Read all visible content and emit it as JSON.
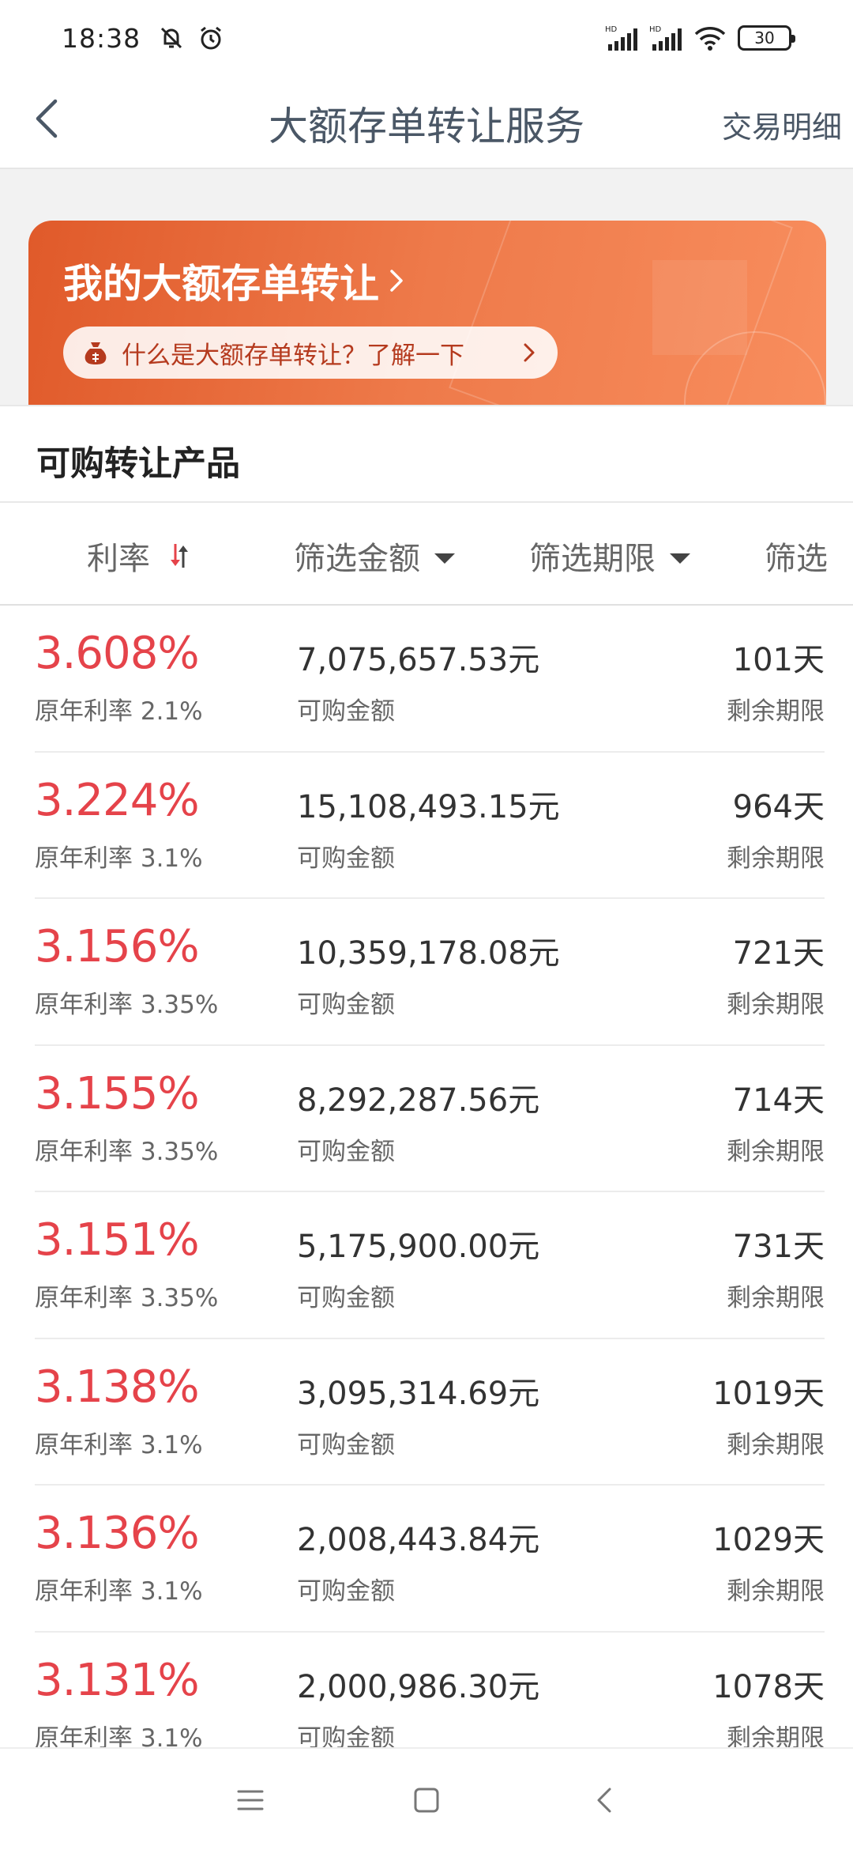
{
  "status": {
    "time": "18:38",
    "battery": "30"
  },
  "nav": {
    "title": "大额存单转让服务",
    "right_link": "交易明细"
  },
  "banner": {
    "title": "我的大额存单转让",
    "pill_text": "什么是大额存单转让？了解一下"
  },
  "section": {
    "title": "可购转让产品"
  },
  "filters": [
    {
      "label": "利率"
    },
    {
      "label": "筛选金额"
    },
    {
      "label": "筛选期限"
    },
    {
      "label": "筛选"
    }
  ],
  "products": [
    {
      "rate": "3.608%",
      "orig": "原年利率 2.1%",
      "amount": "7,075,657.53元",
      "amount_label": "可购金额",
      "term": "101天",
      "term_label": "剩余期限"
    },
    {
      "rate": "3.224%",
      "orig": "原年利率 3.1%",
      "amount": "15,108,493.15元",
      "amount_label": "可购金额",
      "term": "964天",
      "term_label": "剩余期限"
    },
    {
      "rate": "3.156%",
      "orig": "原年利率 3.35%",
      "amount": "10,359,178.08元",
      "amount_label": "可购金额",
      "term": "721天",
      "term_label": "剩余期限"
    },
    {
      "rate": "3.155%",
      "orig": "原年利率 3.35%",
      "amount": "8,292,287.56元",
      "amount_label": "可购金额",
      "term": "714天",
      "term_label": "剩余期限"
    },
    {
      "rate": "3.151%",
      "orig": "原年利率 3.35%",
      "amount": "5,175,900.00元",
      "amount_label": "可购金额",
      "term": "731天",
      "term_label": "剩余期限"
    },
    {
      "rate": "3.138%",
      "orig": "原年利率 3.1%",
      "amount": "3,095,314.69元",
      "amount_label": "可购金额",
      "term": "1019天",
      "term_label": "剩余期限"
    },
    {
      "rate": "3.136%",
      "orig": "原年利率 3.1%",
      "amount": "2,008,443.84元",
      "amount_label": "可购金额",
      "term": "1029天",
      "term_label": "剩余期限"
    },
    {
      "rate": "3.131%",
      "orig": "原年利率 3.1%",
      "amount": "2,000,986.30元",
      "amount_label": "可购金额",
      "term": "1078天",
      "term_label": "剩余期限"
    }
  ],
  "colors": {
    "rate_red": "#e5434a",
    "banner_orange": "#ee7a4a",
    "nav_text": "#4a5766"
  },
  "icons": {
    "status_left": [
      "bell-off-icon",
      "alarm-icon"
    ],
    "status_right": [
      "signal-hd-icon",
      "signal-hd-icon",
      "wifi-icon",
      "battery-icon"
    ],
    "nav_back": "back-arrow-icon",
    "pill": "money-bag-icon",
    "sort": "sort-arrows-icon",
    "bottom": [
      "menu-icon",
      "home-square-icon",
      "back-icon"
    ]
  }
}
